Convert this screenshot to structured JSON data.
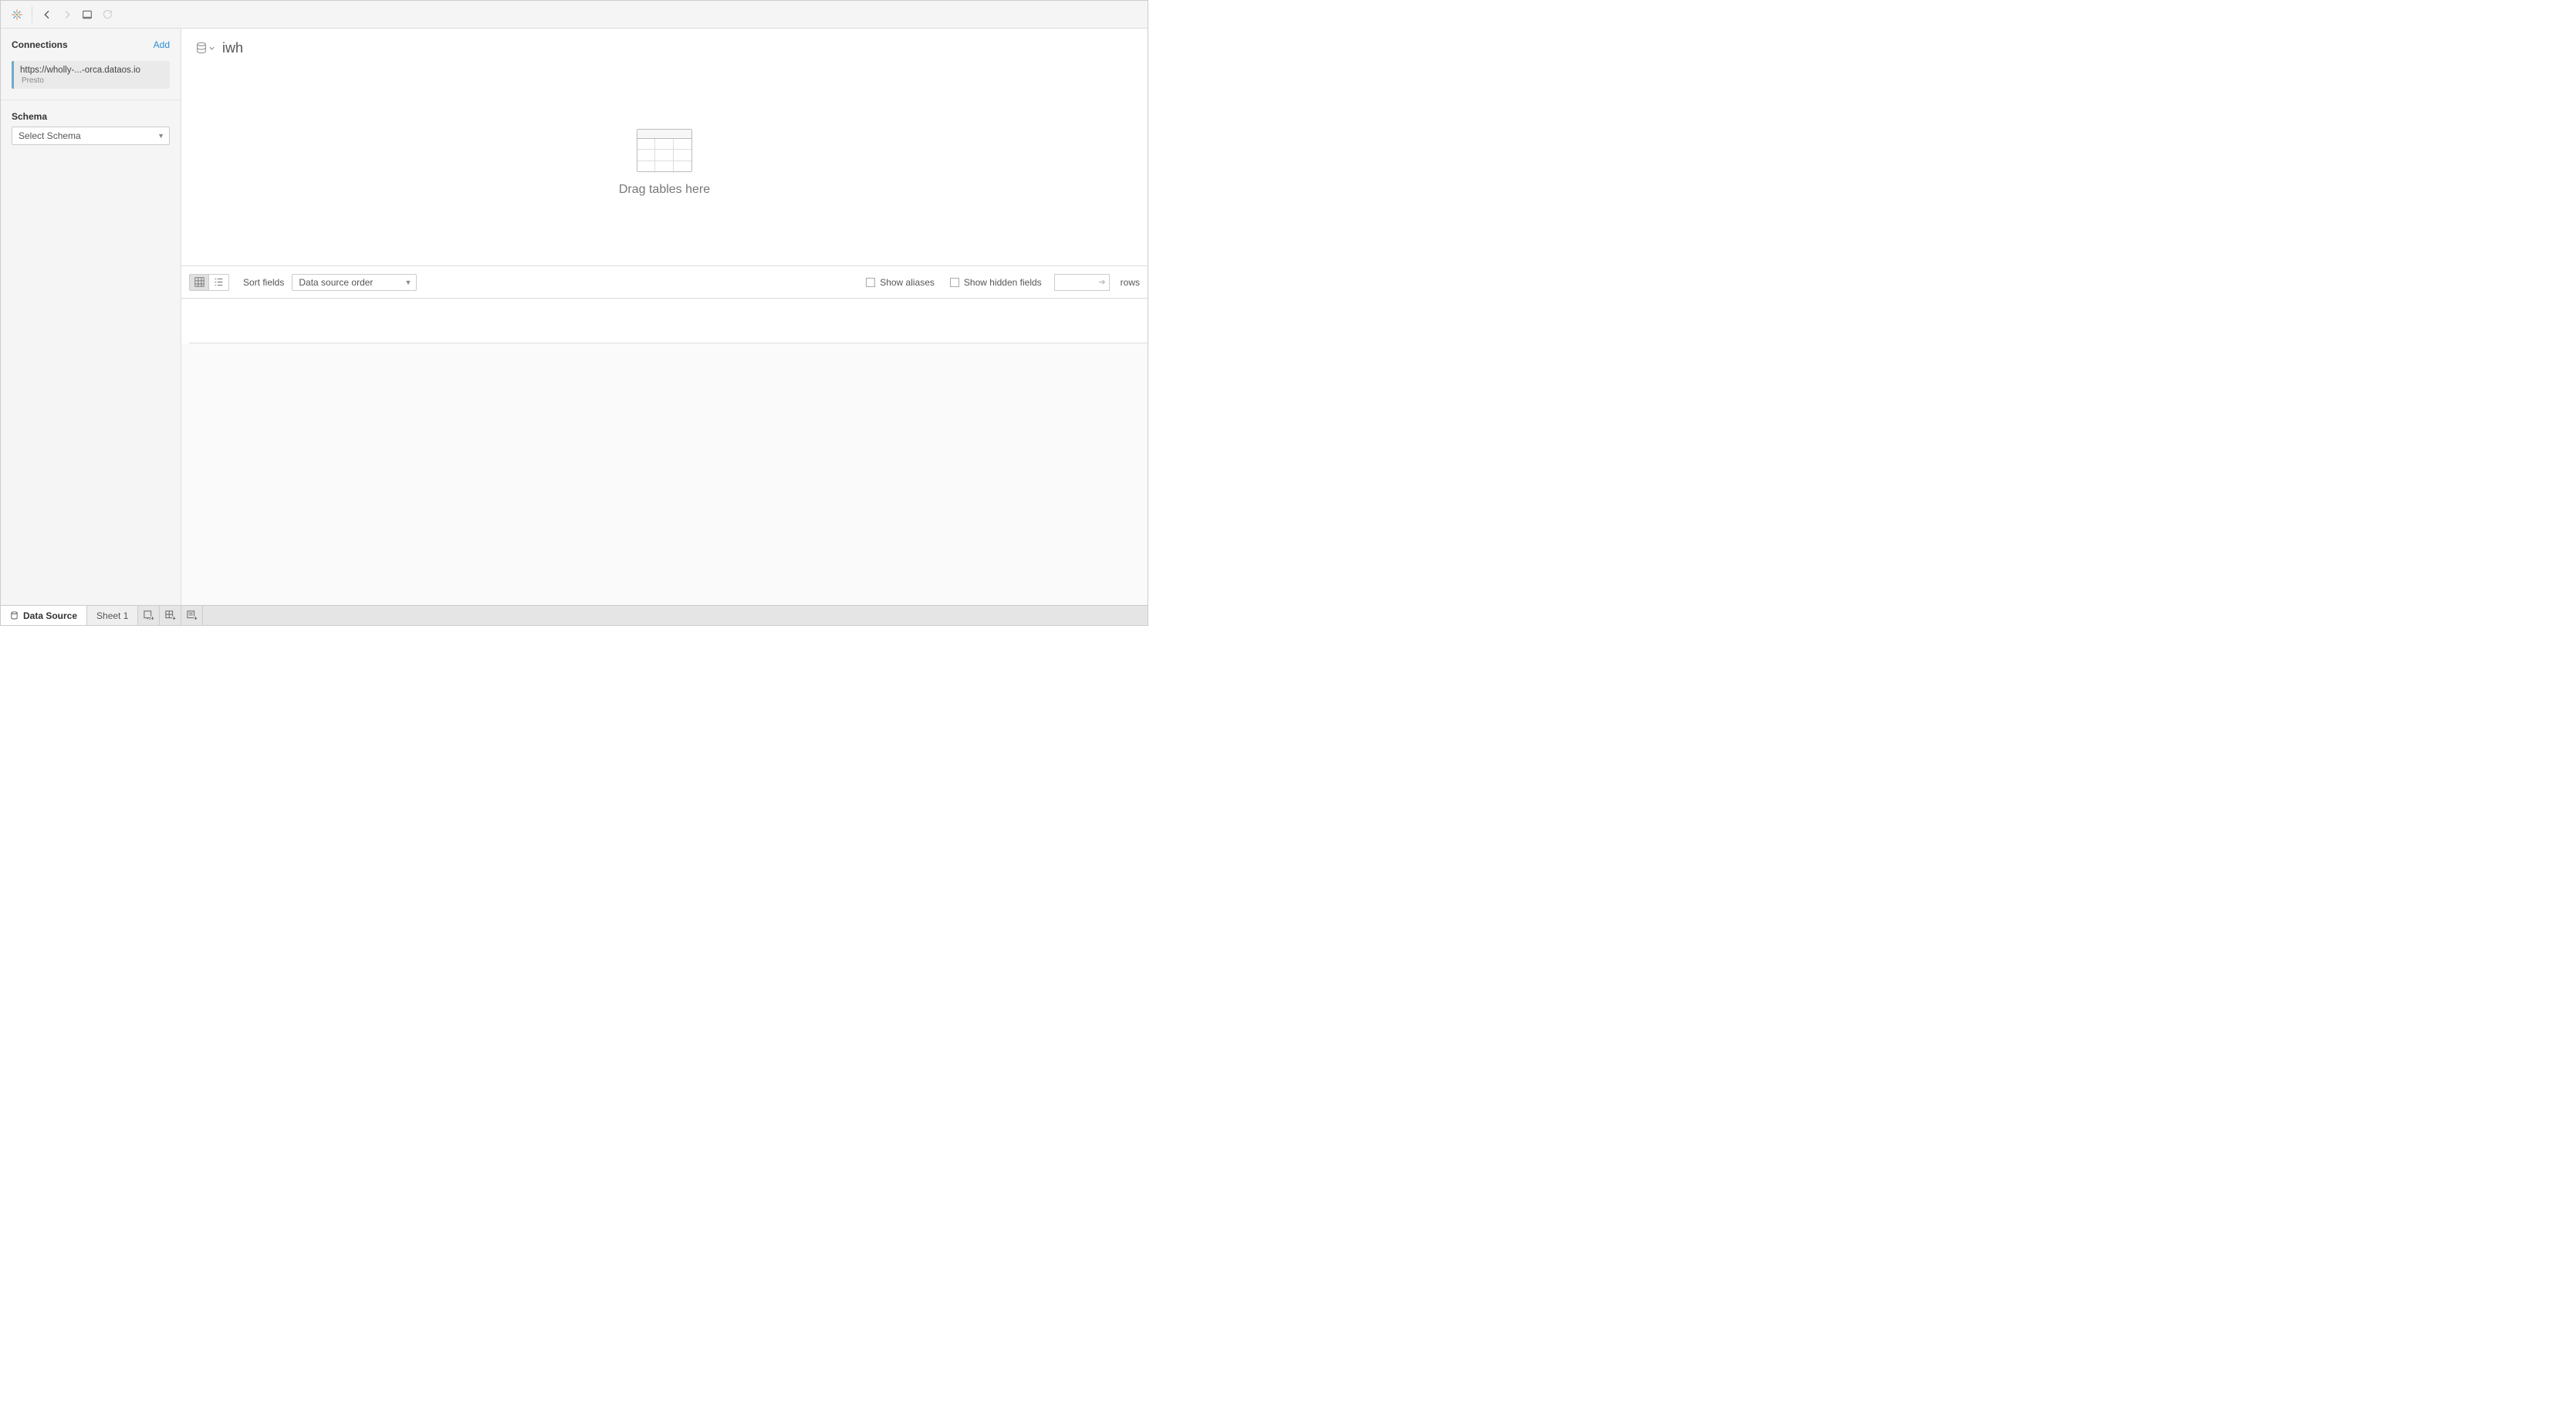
{
  "sidebar": {
    "connections_title": "Connections",
    "add_label": "Add",
    "connection": {
      "url": "https://wholly-...-orca.dataos.io",
      "type": "Presto"
    },
    "schema_title": "Schema",
    "schema_placeholder": "Select Schema"
  },
  "datasource": {
    "name": "iwh"
  },
  "canvas": {
    "drag_hint": "Drag tables here"
  },
  "controls": {
    "sort_label": "Sort fields",
    "sort_value": "Data source order",
    "show_aliases": "Show aliases",
    "show_hidden": "Show hidden fields",
    "rows_label": "rows"
  },
  "tabs": {
    "data_source": "Data Source",
    "sheet1": "Sheet 1"
  }
}
